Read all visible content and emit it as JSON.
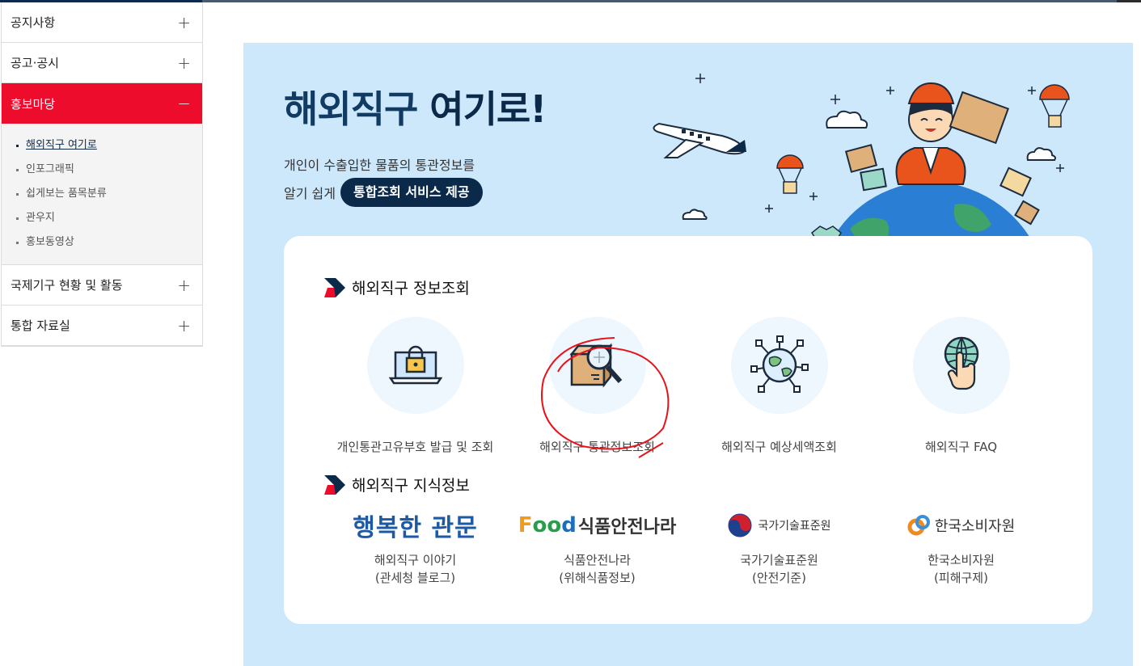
{
  "sidebar": {
    "items": [
      {
        "label": "공지사항",
        "sign": "+"
      },
      {
        "label": "공고·공시",
        "sign": "+"
      },
      {
        "label": "홍보마당",
        "sign": "−"
      },
      {
        "label": "국제기구 현황 및 활동",
        "sign": "+"
      },
      {
        "label": "통합 자료실",
        "sign": "+"
      }
    ],
    "submenu": [
      "해외직구 여기로",
      "인포그래픽",
      "쉽게보는 품목분류",
      "관우지",
      "홍보동영상"
    ]
  },
  "hero": {
    "title_normal": "해외직구 ",
    "title_bold": "여기로!",
    "line1": "개인이 수출입한 물품의 통관정보를",
    "line2": "알기 쉽게",
    "pill": "통합조회 서비스 제공"
  },
  "section_info": {
    "title": "해외직구 정보조회",
    "services": [
      {
        "label": "개인통관고유부호 발급 및 조회",
        "icon": "laptop-lock-icon"
      },
      {
        "label": "해외직구 통관정보조회",
        "icon": "box-magnifier-icon"
      },
      {
        "label": "해외직구 예상세액조회",
        "icon": "globe-network-icon"
      },
      {
        "label": "해외직구 FAQ",
        "icon": "globe-hand-icon"
      }
    ]
  },
  "section_knowledge": {
    "title": "해외직구 지식정보",
    "items": [
      {
        "logo": "행복한 관문",
        "line1": "해외직구 이야기",
        "line2": "(관세청 블로그)"
      },
      {
        "logo_f": "F",
        "logo_oo": "oo",
        "logo_d": "d",
        "logo_text": "식품안전나라",
        "line1": "식품안전나라",
        "line2": "(위해식품정보)"
      },
      {
        "logo": "국가기술표준원",
        "line1": "국가기술표준원",
        "line2": "(안전기준)"
      },
      {
        "logo": "한국소비자원",
        "line1": "한국소비자원",
        "line2": "(피해구제)"
      }
    ]
  },
  "colors": {
    "accent_red": "#ee0c2c",
    "navy": "#0b2a4a",
    "panel_bg": "#cde7fb"
  }
}
